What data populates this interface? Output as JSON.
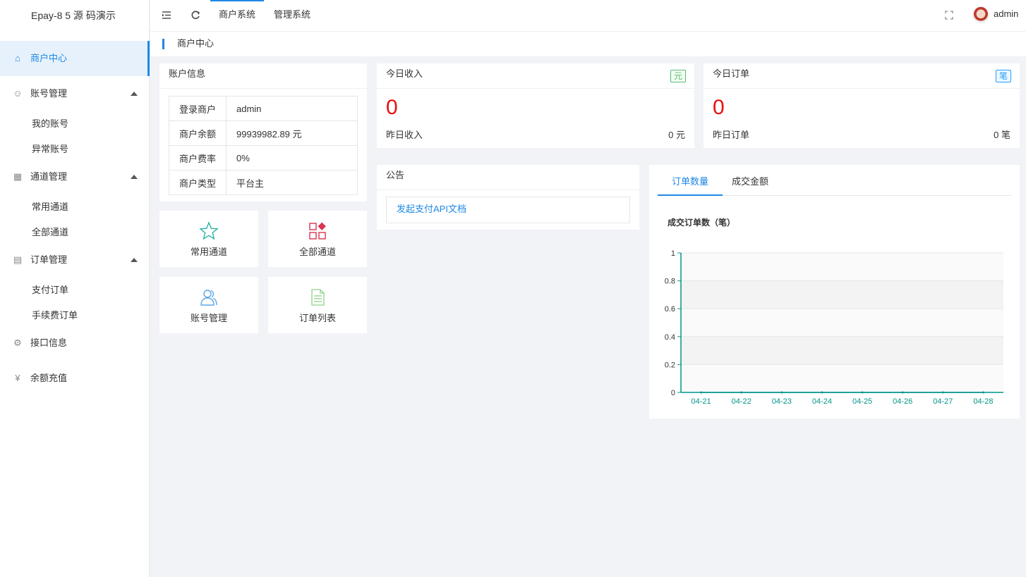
{
  "app": {
    "logo": "Epay-8 5 源 码演示"
  },
  "header": {
    "nav": [
      "商户系统",
      "管理系统"
    ],
    "user": "admin"
  },
  "sidebar": {
    "items": [
      {
        "label": "商户中心",
        "icon": "home-icon",
        "active": true
      },
      {
        "label": "账号管理",
        "icon": "users-icon",
        "sub": [
          "我的账号",
          "异常账号"
        ]
      },
      {
        "label": "通道管理",
        "icon": "apps-icon",
        "sub": [
          "常用通道",
          "全部通道"
        ]
      },
      {
        "label": "订单管理",
        "icon": "document-icon",
        "sub": [
          "支付订单",
          "手续费订单"
        ]
      },
      {
        "label": "接口信息",
        "icon": "gear-icon"
      },
      {
        "label": "余额充值",
        "icon": "yen-icon"
      }
    ]
  },
  "breadcrumb": "商户中心",
  "account": {
    "title": "账户信息",
    "rows": [
      {
        "k": "登录商户",
        "v": "admin"
      },
      {
        "k": "商户余额",
        "v": "99939982.89 元"
      },
      {
        "k": "商户费率",
        "v": "0%"
      },
      {
        "k": "商户类型",
        "v": "平台主"
      }
    ]
  },
  "income": {
    "title": "今日收入",
    "badge": "元",
    "value": "0",
    "sub_label": "昨日收入",
    "sub_value": "0 元"
  },
  "orders": {
    "title": "今日订单",
    "badge": "笔",
    "value": "0",
    "sub_label": "昨日订单",
    "sub_value": "0 笔"
  },
  "quick": [
    "常用通道",
    "全部通道",
    "账号管理",
    "订单列表"
  ],
  "notice": {
    "title": "公告",
    "link": "发起支付API文档"
  },
  "chart_tabs": [
    "订单数量",
    "成交金额"
  ],
  "colors": {
    "accent": "#1e88e5",
    "stat": "#e81010",
    "axis": "#009688"
  },
  "chart_data": {
    "type": "line",
    "title": "成交订单数（笔）",
    "categories": [
      "04-21",
      "04-22",
      "04-23",
      "04-24",
      "04-25",
      "04-26",
      "04-27",
      "04-28"
    ],
    "series": [
      {
        "values": [
          0,
          0,
          0,
          0,
          0,
          0,
          0,
          0
        ]
      }
    ],
    "ylim": [
      0,
      1
    ],
    "yticks": [
      "0",
      "0.2",
      "0.4",
      "0.6",
      "0.8",
      "1"
    ]
  }
}
